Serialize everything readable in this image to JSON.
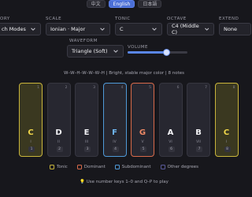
{
  "languages": [
    {
      "label": "中文",
      "active": false
    },
    {
      "label": "English",
      "active": true
    },
    {
      "label": "日本語",
      "active": false
    }
  ],
  "controls": {
    "category": {
      "label": "ORY",
      "value": "ch Modes"
    },
    "scale": {
      "label": "SCALE",
      "value": "Ionian · Major"
    },
    "tonic": {
      "label": "TONIC",
      "value": "C"
    },
    "octave": {
      "label": "OCTAVE",
      "value": "C4 (Middle C)"
    },
    "extend": {
      "label": "EXTEND",
      "value": "None"
    },
    "waveform": {
      "label": "WAVEFORM",
      "value": "Triangle (Soft)"
    },
    "volume": {
      "label": "VOLUME",
      "level_percent": 65
    }
  },
  "scale_info": "W–W–H–W–W–W–H | Bright, stable major color | 8 notes",
  "keys": [
    {
      "note": "C",
      "roman": "I",
      "num": "1",
      "deg": "1",
      "role": "tonic"
    },
    {
      "note": "D",
      "roman": "II",
      "num": "2",
      "deg": "2",
      "role": "other"
    },
    {
      "note": "E",
      "roman": "III",
      "num": "3",
      "deg": "3",
      "role": "other"
    },
    {
      "note": "F",
      "roman": "IV",
      "num": "4",
      "deg": "4",
      "role": "subdominant"
    },
    {
      "note": "G",
      "roman": "V",
      "num": "5",
      "deg": "5",
      "role": "dominant"
    },
    {
      "note": "A",
      "roman": "VI",
      "num": "6",
      "deg": "6",
      "role": "other"
    },
    {
      "note": "B",
      "roman": "VII",
      "num": "7",
      "deg": "7",
      "role": "other"
    },
    {
      "note": "C",
      "roman": "I",
      "num": "8",
      "deg": "8",
      "role": "tonic"
    }
  ],
  "legend": [
    {
      "label": "Tonic",
      "color": "#c9b53b"
    },
    {
      "label": "Dominant",
      "color": "#d86a4a"
    },
    {
      "label": "Subdominant",
      "color": "#4f9ad8"
    },
    {
      "label": "Other degrees",
      "color": "#5a5a9a"
    }
  ],
  "hint": "Use number keys 1–0 and Q–P to play",
  "colors": {
    "accent": "#4b6fd6",
    "background": "#17171c"
  }
}
